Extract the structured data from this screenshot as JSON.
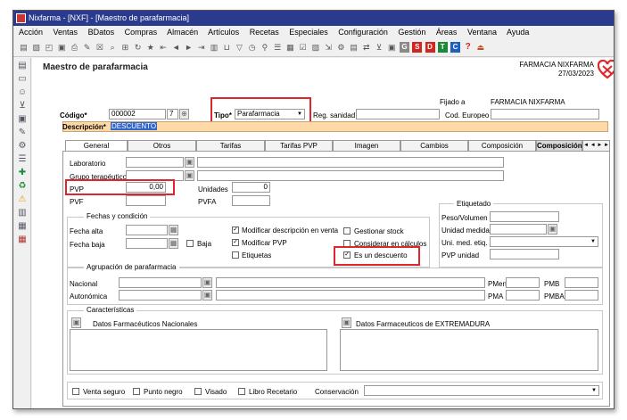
{
  "window": {
    "title": "Nixfarma - [NXF] - [Maestro de parafarmacia]"
  },
  "menu": [
    "Acción",
    "Ventas",
    "BDatos",
    "Compras",
    "Almacén",
    "Artículos",
    "Recetas",
    "Especiales",
    "Configuración",
    "Gestión",
    "Áreas",
    "Ventana",
    "Ayuda"
  ],
  "toolbar_letters": [
    "S",
    "D",
    "T",
    "C",
    "?"
  ],
  "header": {
    "title": "Maestro de parafarmacia",
    "pharmacy": "FARMACIA NIXFARMA",
    "date": "27/03/2023"
  },
  "top": {
    "codigo_label": "Código*",
    "codigo_value": "000002",
    "codigo_digit": "7",
    "tipo_label": "Tipo*",
    "tipo_value": "Parafarmacia",
    "reg_sanidad_label": "Reg. sanidad",
    "reg_sanidad_value": "",
    "fijado_label": "Fijado a",
    "fijado_value": "FARMACIA NIXFARMA",
    "cod_europeo_label": "Cod. Europeo",
    "cod_europeo_value": "",
    "descripcion_label": "Descripción*",
    "descripcion_value": "DESCUENTO"
  },
  "tabs": [
    "General",
    "Otros",
    "Tarifas",
    "Tarifas PVP",
    "Imagen",
    "Cambios",
    "Composición",
    "Composición"
  ],
  "tab_arrows": [
    "◄",
    "◄",
    "►",
    "►"
  ],
  "general": {
    "laboratorio_label": "Laboratorio",
    "grupo_label": "Grupo terapéutico",
    "pvp_label": "PVP",
    "pvp_value": "0,00",
    "pvf_label": "PVF",
    "unidades_label": "Unidades",
    "unidades_value": "0",
    "pvfa_label": "PVFA",
    "fechas_title": "Fechas y condición",
    "fecha_alta_label": "Fecha alta",
    "fecha_baja_label": "Fecha baja",
    "baja_label": "Baja",
    "checks": {
      "modificar_desc": {
        "label": "Modificar descripción en venta",
        "checked": true
      },
      "modificar_pvp": {
        "label": "Modificar PVP",
        "checked": true
      },
      "etiquetas": {
        "label": "Etiquetas",
        "checked": false
      },
      "gestionar_stock": {
        "label": "Gestionar stock",
        "checked": false
      },
      "considerar": {
        "label": "Considerar en cálculos",
        "checked": false
      },
      "es_descuento": {
        "label": "Es un descuento",
        "checked": true
      }
    },
    "etiquetado_title": "Etiquetado",
    "peso_label": "Peso/Volumen",
    "unidad_medida_label": "Unidad medida",
    "uni_med_label": "Uni. med. etiq.",
    "pvp_unidad_label": "PVP unidad",
    "agrupacion_title": "Agrupación de parafarmacia",
    "nacional_label": "Nacional",
    "autonomica_label": "Autonómica",
    "pmen_label": "PMen",
    "pmb_label": "PMB",
    "pma_label": "PMA",
    "pmba_label": "PMBA",
    "caracteristicas_title": "Características",
    "datos_nacionales": "Datos Farmacéuticos Nacionales",
    "datos_extremadura": "Datos Farmaceuticos de EXTREMADURA",
    "bottom_checks": [
      "Venta seguro",
      "Punto negro",
      "Visado",
      "Libro Recetario"
    ],
    "conservacion_label": "Conservación"
  },
  "colors": {
    "title_bar": "#2a3a8c",
    "header_title": "#222222",
    "description_highlight": "#fdd9a7",
    "selection": "#3066cc",
    "annotation": "#e0262b"
  }
}
